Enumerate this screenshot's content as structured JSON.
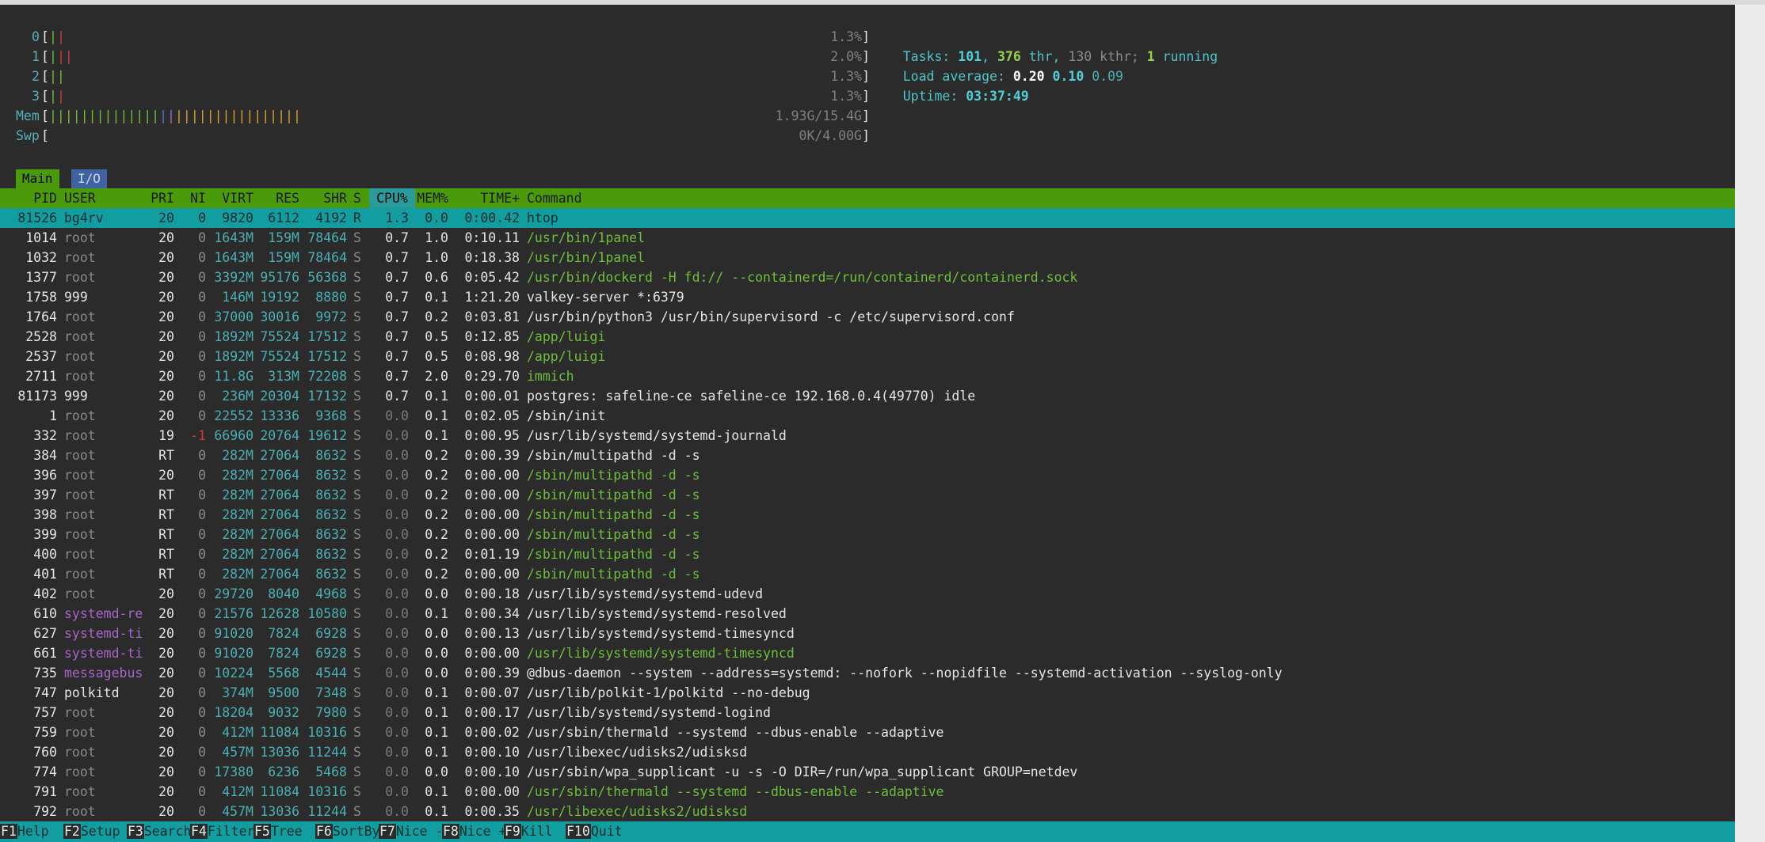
{
  "meters": {
    "cpus": [
      {
        "label": "0",
        "value": "1.3%",
        "bars": [
          [
            "g",
            "|"
          ],
          [
            "r",
            "|"
          ]
        ]
      },
      {
        "label": "1",
        "value": "2.0%",
        "bars": [
          [
            "g",
            "|"
          ],
          [
            "r",
            "||"
          ]
        ]
      },
      {
        "label": "2",
        "value": "1.3%",
        "bars": [
          [
            "g",
            "||"
          ]
        ]
      },
      {
        "label": "3",
        "value": "1.3%",
        "bars": [
          [
            "g",
            "|"
          ],
          [
            "r",
            "|"
          ]
        ]
      }
    ],
    "mem": {
      "label": "Mem",
      "value": "1.93G/15.4G",
      "bars": [
        [
          "g",
          "||||||||||||||"
        ],
        [
          "b",
          "|"
        ],
        [
          "pu",
          "|"
        ],
        [
          "y",
          "||||||||||||||||"
        ]
      ]
    },
    "swp": {
      "label": "Swp",
      "value": "0K/4.00G",
      "bars": []
    }
  },
  "system": {
    "tasks_label": "Tasks: ",
    "tasks": "101",
    "sep1": ", ",
    "threads": "376",
    "thr_label": " thr, ",
    "kthreads": "130 kthr;",
    "sep2": " ",
    "running": "1",
    "running_label": " running",
    "load_label": "Load average: ",
    "load1": "0.20",
    "load5": "0.10",
    "load15": "0.09",
    "uptime_label": "Uptime: ",
    "uptime": "03:37:49"
  },
  "tabs": {
    "main": "Main",
    "io": "I/O"
  },
  "columns": {
    "pid": "PID",
    "user": "USER",
    "pri": "PRI",
    "ni": "NI",
    "virt": "VIRT",
    "res": "RES",
    "shr": "SHR",
    "s": "S",
    "cpu": "CPU%",
    "mem": "MEM%",
    "time": "TIME+",
    "cmd": "Command"
  },
  "processes": [
    {
      "pid": "81526",
      "user": "bg4rv",
      "pri": "20",
      "ni": "0",
      "virt": "9820",
      "res": "6112",
      "shr": "4192",
      "s": "R",
      "cpu": "1.3",
      "mem": "0.0",
      "time": "0:00.42",
      "cmd": "htop",
      "sel": true
    },
    {
      "pid": "1014",
      "user": "root",
      "pri": "20",
      "ni": "0",
      "virt": "1643M",
      "res": "159M",
      "shr": "78464",
      "s": "S",
      "cpu": "0.7",
      "mem": "1.0",
      "time": "0:10.11",
      "cmd": "/usr/bin/1panel",
      "cg": true
    },
    {
      "pid": "1032",
      "user": "root",
      "pri": "20",
      "ni": "0",
      "virt": "1643M",
      "res": "159M",
      "shr": "78464",
      "s": "S",
      "cpu": "0.7",
      "mem": "1.0",
      "time": "0:18.38",
      "cmd": "/usr/bin/1panel",
      "cg": true
    },
    {
      "pid": "1377",
      "user": "root",
      "pri": "20",
      "ni": "0",
      "virt": "3392M",
      "res": "95176",
      "shr": "56368",
      "s": "S",
      "cpu": "0.7",
      "mem": "0.6",
      "time": "0:05.42",
      "cmd": "/usr/bin/dockerd -H fd:// --containerd=/run/containerd/containerd.sock",
      "cg": true
    },
    {
      "pid": "1758",
      "user": "999",
      "pri": "20",
      "ni": "0",
      "virt": "146M",
      "res": "19192",
      "shr": "8880",
      "s": "S",
      "cpu": "0.7",
      "mem": "0.1",
      "time": "1:21.20",
      "cmd": "valkey-server *:6379"
    },
    {
      "pid": "1764",
      "user": "root",
      "pri": "20",
      "ni": "0",
      "virt": "37000",
      "res": "30016",
      "shr": "9972",
      "s": "S",
      "cpu": "0.7",
      "mem": "0.2",
      "time": "0:03.81",
      "cmd": "/usr/bin/python3 /usr/bin/supervisord -c /etc/supervisord.conf"
    },
    {
      "pid": "2528",
      "user": "root",
      "pri": "20",
      "ni": "0",
      "virt": "1892M",
      "res": "75524",
      "shr": "17512",
      "s": "S",
      "cpu": "0.7",
      "mem": "0.5",
      "time": "0:12.85",
      "cmd": "/app/luigi",
      "cg": true
    },
    {
      "pid": "2537",
      "user": "root",
      "pri": "20",
      "ni": "0",
      "virt": "1892M",
      "res": "75524",
      "shr": "17512",
      "s": "S",
      "cpu": "0.7",
      "mem": "0.5",
      "time": "0:08.98",
      "cmd": "/app/luigi",
      "cg": true
    },
    {
      "pid": "2711",
      "user": "root",
      "pri": "20",
      "ni": "0",
      "virt": "11.8G",
      "res": "313M",
      "shr": "72208",
      "s": "S",
      "cpu": "0.7",
      "mem": "2.0",
      "time": "0:29.70",
      "cmd": "immich",
      "cg": true
    },
    {
      "pid": "81173",
      "user": "999",
      "pri": "20",
      "ni": "0",
      "virt": "236M",
      "res": "20304",
      "shr": "17132",
      "s": "S",
      "cpu": "0.7",
      "mem": "0.1",
      "time": "0:00.01",
      "cmd": "postgres: safeline-ce safeline-ce 192.168.0.4(49770) idle"
    },
    {
      "pid": "1",
      "user": "root",
      "pri": "20",
      "ni": "0",
      "virt": "22552",
      "res": "13336",
      "shr": "9368",
      "s": "S",
      "cpu": "0.0",
      "mem": "0.1",
      "time": "0:02.05",
      "cmd": "/sbin/init"
    },
    {
      "pid": "332",
      "user": "root",
      "pri": "19",
      "ni": "-1",
      "virt": "66960",
      "res": "20764",
      "shr": "19612",
      "s": "S",
      "cpu": "0.0",
      "mem": "0.1",
      "time": "0:00.95",
      "cmd": "/usr/lib/systemd/systemd-journald"
    },
    {
      "pid": "384",
      "user": "root",
      "pri": "RT",
      "ni": "0",
      "virt": "282M",
      "res": "27064",
      "shr": "8632",
      "s": "S",
      "cpu": "0.0",
      "mem": "0.2",
      "time": "0:00.39",
      "cmd": "/sbin/multipathd -d -s"
    },
    {
      "pid": "396",
      "user": "root",
      "pri": "20",
      "ni": "0",
      "virt": "282M",
      "res": "27064",
      "shr": "8632",
      "s": "S",
      "cpu": "0.0",
      "mem": "0.2",
      "time": "0:00.00",
      "cmd": "/sbin/multipathd -d -s",
      "cg": true
    },
    {
      "pid": "397",
      "user": "root",
      "pri": "RT",
      "ni": "0",
      "virt": "282M",
      "res": "27064",
      "shr": "8632",
      "s": "S",
      "cpu": "0.0",
      "mem": "0.2",
      "time": "0:00.00",
      "cmd": "/sbin/multipathd -d -s",
      "cg": true
    },
    {
      "pid": "398",
      "user": "root",
      "pri": "RT",
      "ni": "0",
      "virt": "282M",
      "res": "27064",
      "shr": "8632",
      "s": "S",
      "cpu": "0.0",
      "mem": "0.2",
      "time": "0:00.00",
      "cmd": "/sbin/multipathd -d -s",
      "cg": true
    },
    {
      "pid": "399",
      "user": "root",
      "pri": "RT",
      "ni": "0",
      "virt": "282M",
      "res": "27064",
      "shr": "8632",
      "s": "S",
      "cpu": "0.0",
      "mem": "0.2",
      "time": "0:00.00",
      "cmd": "/sbin/multipathd -d -s",
      "cg": true
    },
    {
      "pid": "400",
      "user": "root",
      "pri": "RT",
      "ni": "0",
      "virt": "282M",
      "res": "27064",
      "shr": "8632",
      "s": "S",
      "cpu": "0.0",
      "mem": "0.2",
      "time": "0:01.19",
      "cmd": "/sbin/multipathd -d -s",
      "cg": true
    },
    {
      "pid": "401",
      "user": "root",
      "pri": "RT",
      "ni": "0",
      "virt": "282M",
      "res": "27064",
      "shr": "8632",
      "s": "S",
      "cpu": "0.0",
      "mem": "0.2",
      "time": "0:00.00",
      "cmd": "/sbin/multipathd -d -s",
      "cg": true
    },
    {
      "pid": "402",
      "user": "root",
      "pri": "20",
      "ni": "0",
      "virt": "29720",
      "res": "8040",
      "shr": "4968",
      "s": "S",
      "cpu": "0.0",
      "mem": "0.0",
      "time": "0:00.18",
      "cmd": "/usr/lib/systemd/systemd-udevd"
    },
    {
      "pid": "610",
      "user": "systemd-re",
      "pri": "20",
      "ni": "0",
      "virt": "21576",
      "res": "12628",
      "shr": "10580",
      "s": "S",
      "cpu": "0.0",
      "mem": "0.1",
      "time": "0:00.34",
      "cmd": "/usr/lib/systemd/systemd-resolved",
      "up": true
    },
    {
      "pid": "627",
      "user": "systemd-ti",
      "pri": "20",
      "ni": "0",
      "virt": "91020",
      "res": "7824",
      "shr": "6928",
      "s": "S",
      "cpu": "0.0",
      "mem": "0.0",
      "time": "0:00.13",
      "cmd": "/usr/lib/systemd/systemd-timesyncd",
      "up": true
    },
    {
      "pid": "661",
      "user": "systemd-ti",
      "pri": "20",
      "ni": "0",
      "virt": "91020",
      "res": "7824",
      "shr": "6928",
      "s": "S",
      "cpu": "0.0",
      "mem": "0.0",
      "time": "0:00.00",
      "cmd": "/usr/lib/systemd/systemd-timesyncd",
      "up": true,
      "cg": true
    },
    {
      "pid": "735",
      "user": "messagebus",
      "pri": "20",
      "ni": "0",
      "virt": "10224",
      "res": "5568",
      "shr": "4544",
      "s": "S",
      "cpu": "0.0",
      "mem": "0.0",
      "time": "0:00.39",
      "cmd": "@dbus-daemon --system --address=systemd: --nofork --nopidfile --systemd-activation --syslog-only",
      "up": true
    },
    {
      "pid": "747",
      "user": "polkitd",
      "pri": "20",
      "ni": "0",
      "virt": "374M",
      "res": "9500",
      "shr": "7348",
      "s": "S",
      "cpu": "0.0",
      "mem": "0.1",
      "time": "0:00.07",
      "cmd": "/usr/lib/polkit-1/polkitd --no-debug"
    },
    {
      "pid": "757",
      "user": "root",
      "pri": "20",
      "ni": "0",
      "virt": "18204",
      "res": "9032",
      "shr": "7980",
      "s": "S",
      "cpu": "0.0",
      "mem": "0.1",
      "time": "0:00.17",
      "cmd": "/usr/lib/systemd/systemd-logind"
    },
    {
      "pid": "759",
      "user": "root",
      "pri": "20",
      "ni": "0",
      "virt": "412M",
      "res": "11084",
      "shr": "10316",
      "s": "S",
      "cpu": "0.0",
      "mem": "0.1",
      "time": "0:00.02",
      "cmd": "/usr/sbin/thermald --systemd --dbus-enable --adaptive"
    },
    {
      "pid": "760",
      "user": "root",
      "pri": "20",
      "ni": "0",
      "virt": "457M",
      "res": "13036",
      "shr": "11244",
      "s": "S",
      "cpu": "0.0",
      "mem": "0.1",
      "time": "0:00.10",
      "cmd": "/usr/libexec/udisks2/udisksd"
    },
    {
      "pid": "774",
      "user": "root",
      "pri": "20",
      "ni": "0",
      "virt": "17380",
      "res": "6236",
      "shr": "5468",
      "s": "S",
      "cpu": "0.0",
      "mem": "0.0",
      "time": "0:00.10",
      "cmd": "/usr/sbin/wpa_supplicant -u -s -O DIR=/run/wpa_supplicant GROUP=netdev"
    },
    {
      "pid": "791",
      "user": "root",
      "pri": "20",
      "ni": "0",
      "virt": "412M",
      "res": "11084",
      "shr": "10316",
      "s": "S",
      "cpu": "0.0",
      "mem": "0.1",
      "time": "0:00.00",
      "cmd": "/usr/sbin/thermald --systemd --dbus-enable --adaptive",
      "cg": true
    },
    {
      "pid": "792",
      "user": "root",
      "pri": "20",
      "ni": "0",
      "virt": "457M",
      "res": "13036",
      "shr": "11244",
      "s": "S",
      "cpu": "0.0",
      "mem": "0.1",
      "time": "0:00.35",
      "cmd": "/usr/libexec/udisks2/udisksd",
      "cg": true
    }
  ],
  "function_keys": [
    {
      "key": "F1",
      "label": "Help"
    },
    {
      "key": "F2",
      "label": "Setup"
    },
    {
      "key": "F3",
      "label": "Search"
    },
    {
      "key": "F4",
      "label": "Filter"
    },
    {
      "key": "F5",
      "label": "Tree"
    },
    {
      "key": "F6",
      "label": "SortBy"
    },
    {
      "key": "F7",
      "label": "Nice -"
    },
    {
      "key": "F8",
      "label": "Nice +"
    },
    {
      "key": "F9",
      "label": "Kill"
    },
    {
      "key": "F10",
      "label": "Quit"
    }
  ]
}
